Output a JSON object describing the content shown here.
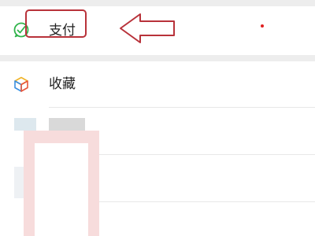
{
  "menu": {
    "items": [
      {
        "label": "支付",
        "icon": "wechat-pay-icon",
        "icon_color": "#2fb34a"
      },
      {
        "label": "收藏",
        "icon": "favorites-cube-icon"
      }
    ]
  },
  "annotation": {
    "highlight_color": "#b8323a",
    "arrow": "left-arrow-outline-icon"
  },
  "colors": {
    "background": "#ededed",
    "row": "#ffffff",
    "text": "#222222",
    "notification_dot": "#e02020"
  }
}
